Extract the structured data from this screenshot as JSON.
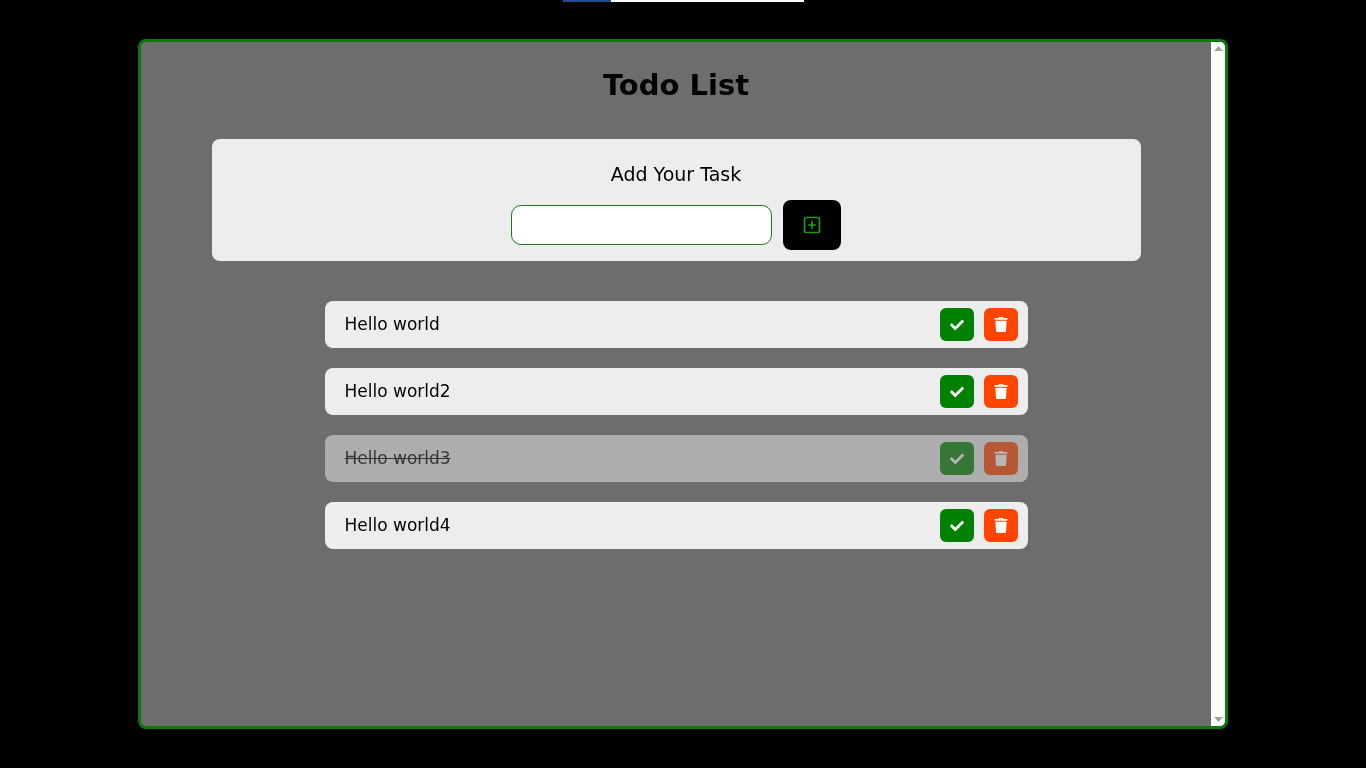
{
  "top_bar": {
    "level": 0.2
  },
  "title": "Todo List",
  "add_task": {
    "label": "Add Your Task"
  },
  "tasks": [
    {
      "text": "Hello world",
      "done": false
    },
    {
      "text": "Hello world2",
      "done": false
    },
    {
      "text": "Hello world3",
      "done": true
    },
    {
      "text": "Hello world4",
      "done": false
    }
  ]
}
